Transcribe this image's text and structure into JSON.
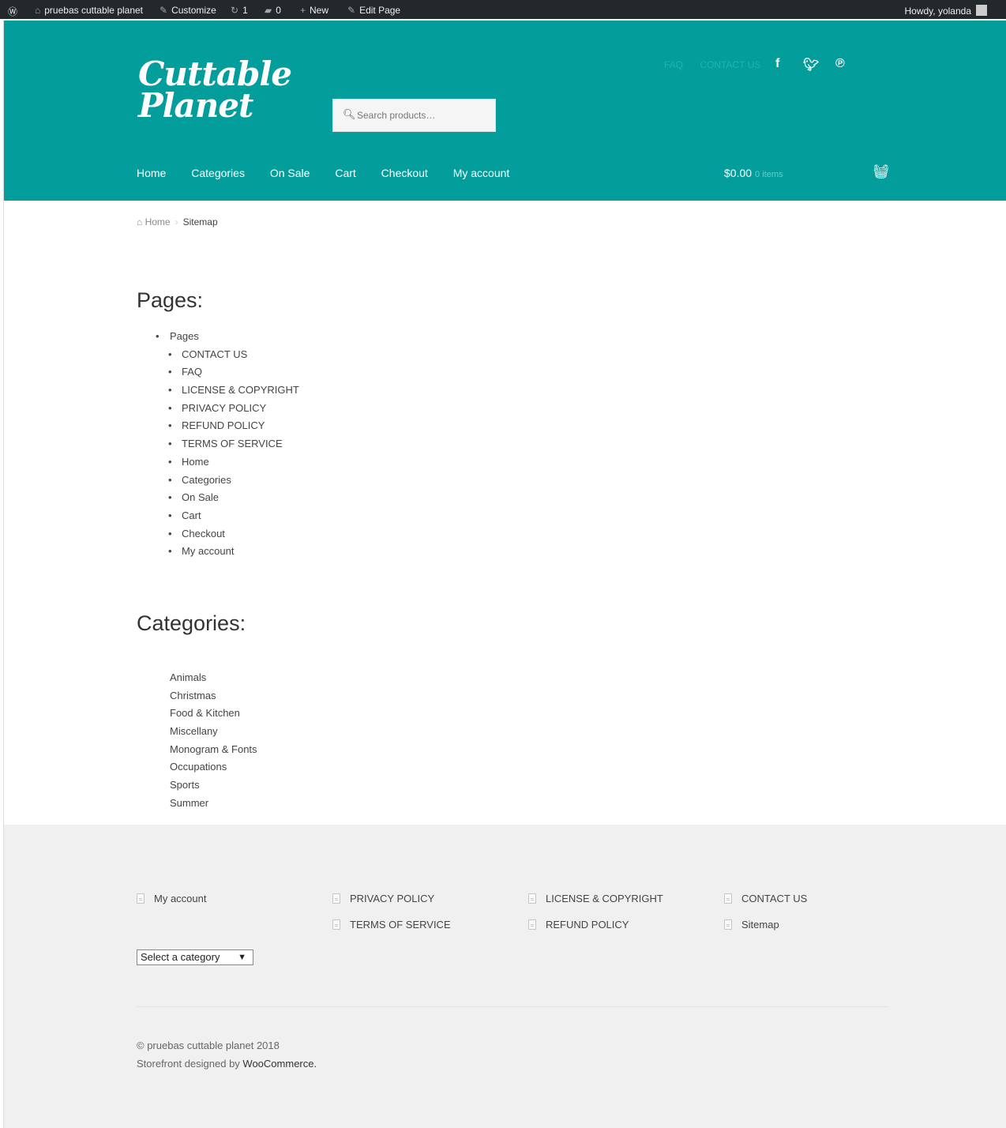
{
  "admin_bar": {
    "site_name": "pruebas cuttable planet",
    "customize": "Customize",
    "updates_count": "1",
    "comments_count": "0",
    "new": "New",
    "edit_page": "Edit Page",
    "howdy": "Howdy, yolanda"
  },
  "header": {
    "logo_line1": "Cuttable",
    "logo_line2": "Planet",
    "search_placeholder": "Search products…",
    "secondary_nav": [
      "FAQ",
      "CONTACT US"
    ],
    "primary_nav": [
      "Home",
      "Categories",
      "On Sale",
      "Cart",
      "Checkout",
      "My account"
    ],
    "cart_amount": "$0.00",
    "cart_count": "0 items",
    "colors": {
      "header_bg": "#039e9b",
      "admin_bar_bg": "#23282d"
    }
  },
  "breadcrumb": {
    "home": "Home",
    "current": "Sitemap"
  },
  "pages_section": {
    "heading": "Pages:",
    "root_item": "Pages",
    "items": [
      "CONTACT US",
      "FAQ",
      "LICENSE & COPYRIGHT",
      "PRIVACY POLICY",
      "REFUND POLICY",
      "TERMS OF SERVICE",
      "Home",
      "Categories",
      "On Sale",
      "Cart",
      "Checkout",
      "My account"
    ]
  },
  "categories_section": {
    "heading": "Categories:",
    "items": [
      "Animals",
      "Christmas",
      "Food & Kitchen",
      "Miscellany",
      "Monogram & Fonts",
      "Occupations",
      "Sports",
      "Summer"
    ]
  },
  "footer": {
    "links": [
      "My account",
      "PRIVACY POLICY",
      "TERMS OF SERVICE",
      "LICENSE & COPYRIGHT",
      "REFUND POLICY",
      "CONTACT US",
      "Sitemap"
    ],
    "category_select": "Select a category",
    "copyright": "© pruebas cuttable planet 2018",
    "credit_prefix": "Storefront designed by ",
    "credit_link": "WooCommerce."
  }
}
